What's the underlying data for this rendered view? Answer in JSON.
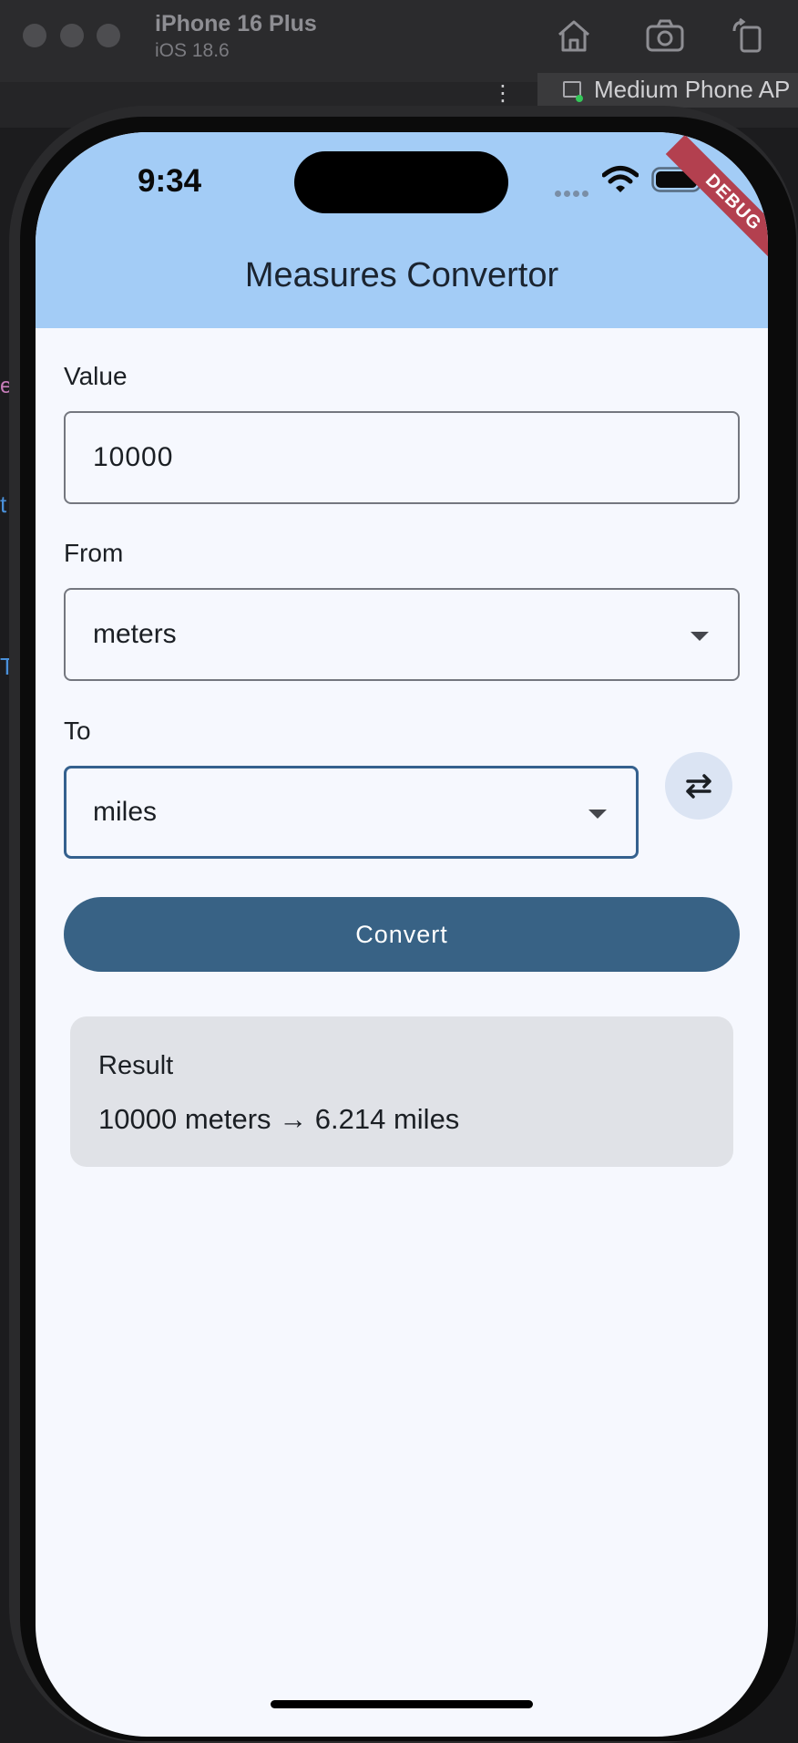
{
  "simulator": {
    "device_name": "iPhone 16 Plus",
    "os_version": "iOS 18.6",
    "toolbar_icons": [
      "home-icon",
      "screenshot-icon",
      "rotate-icon"
    ]
  },
  "ide": {
    "menu_dots": "⋮",
    "device_tab": "Medium Phone AP",
    "left_glyphs": [
      "e",
      "t",
      "T"
    ]
  },
  "status_bar": {
    "time": "9:34",
    "icons": [
      "signal-icon",
      "wifi-icon",
      "battery-icon"
    ]
  },
  "debug_banner": "DEBUG",
  "app_bar": {
    "title": "Measures Convertor"
  },
  "form": {
    "value_label": "Value",
    "value": "10000",
    "from_label": "From",
    "from_selected": "meters",
    "to_label": "To",
    "to_selected": "miles",
    "swap_icon": "swap-horiz-icon",
    "convert_label": "Convert"
  },
  "result": {
    "title": "Result",
    "text": "10000 meters → 6.214 miles"
  },
  "colors": {
    "app_bar": "#a3ccf6",
    "primary": "#386285",
    "background": "#f6f8fe",
    "result_card": "#e0e2e7",
    "debug_ribbon": "#b3404f"
  }
}
